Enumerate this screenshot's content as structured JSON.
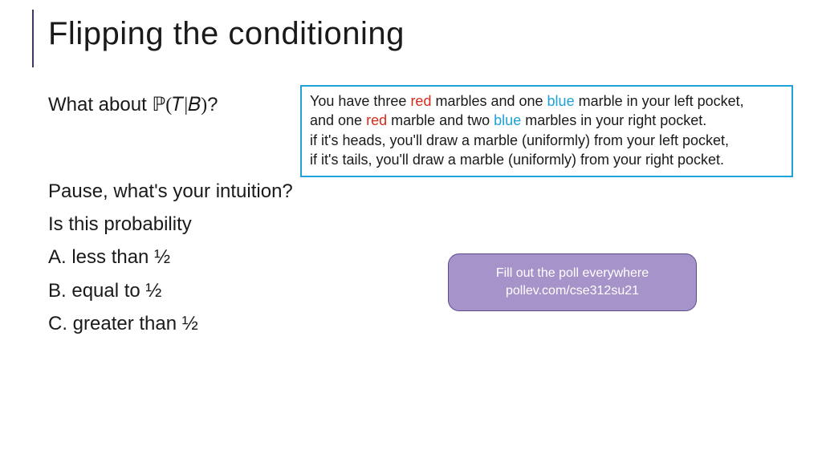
{
  "title": "Flipping the conditioning",
  "question_prefix": "What about ",
  "question_math": "ℙ(𝑇|𝐵)",
  "question_suffix": "?",
  "lines": {
    "pause": "Pause, what's your intuition?",
    "is": "Is this probability",
    "a": "A. less than ½",
    "b": "B. equal to ½",
    "c": "C. greater than ½"
  },
  "callout": {
    "l1_a": "You have three ",
    "l1_red": "red",
    "l1_b": " marbles and one ",
    "l1_blue": "blue",
    "l1_c": " marble in your left pocket,",
    "l2_a": "and one ",
    "l2_red": "red",
    "l2_b": " marble and two ",
    "l2_blue": "blue",
    "l2_c": " marbles in your right pocket.",
    "l3": "if it's heads, you'll draw a marble (uniformly) from your left pocket,",
    "l4": "if it's tails, you'll draw a marble (uniformly) from your right pocket."
  },
  "poll": {
    "line1": "Fill out the poll everywhere",
    "line2": "pollev.com/cse312su21"
  },
  "colors": {
    "accent_border": "#1da1d6",
    "red": "#d62c1a",
    "blue": "#1da1d6",
    "poll_bg": "#a593c9",
    "poll_border": "#5c4b8b"
  }
}
